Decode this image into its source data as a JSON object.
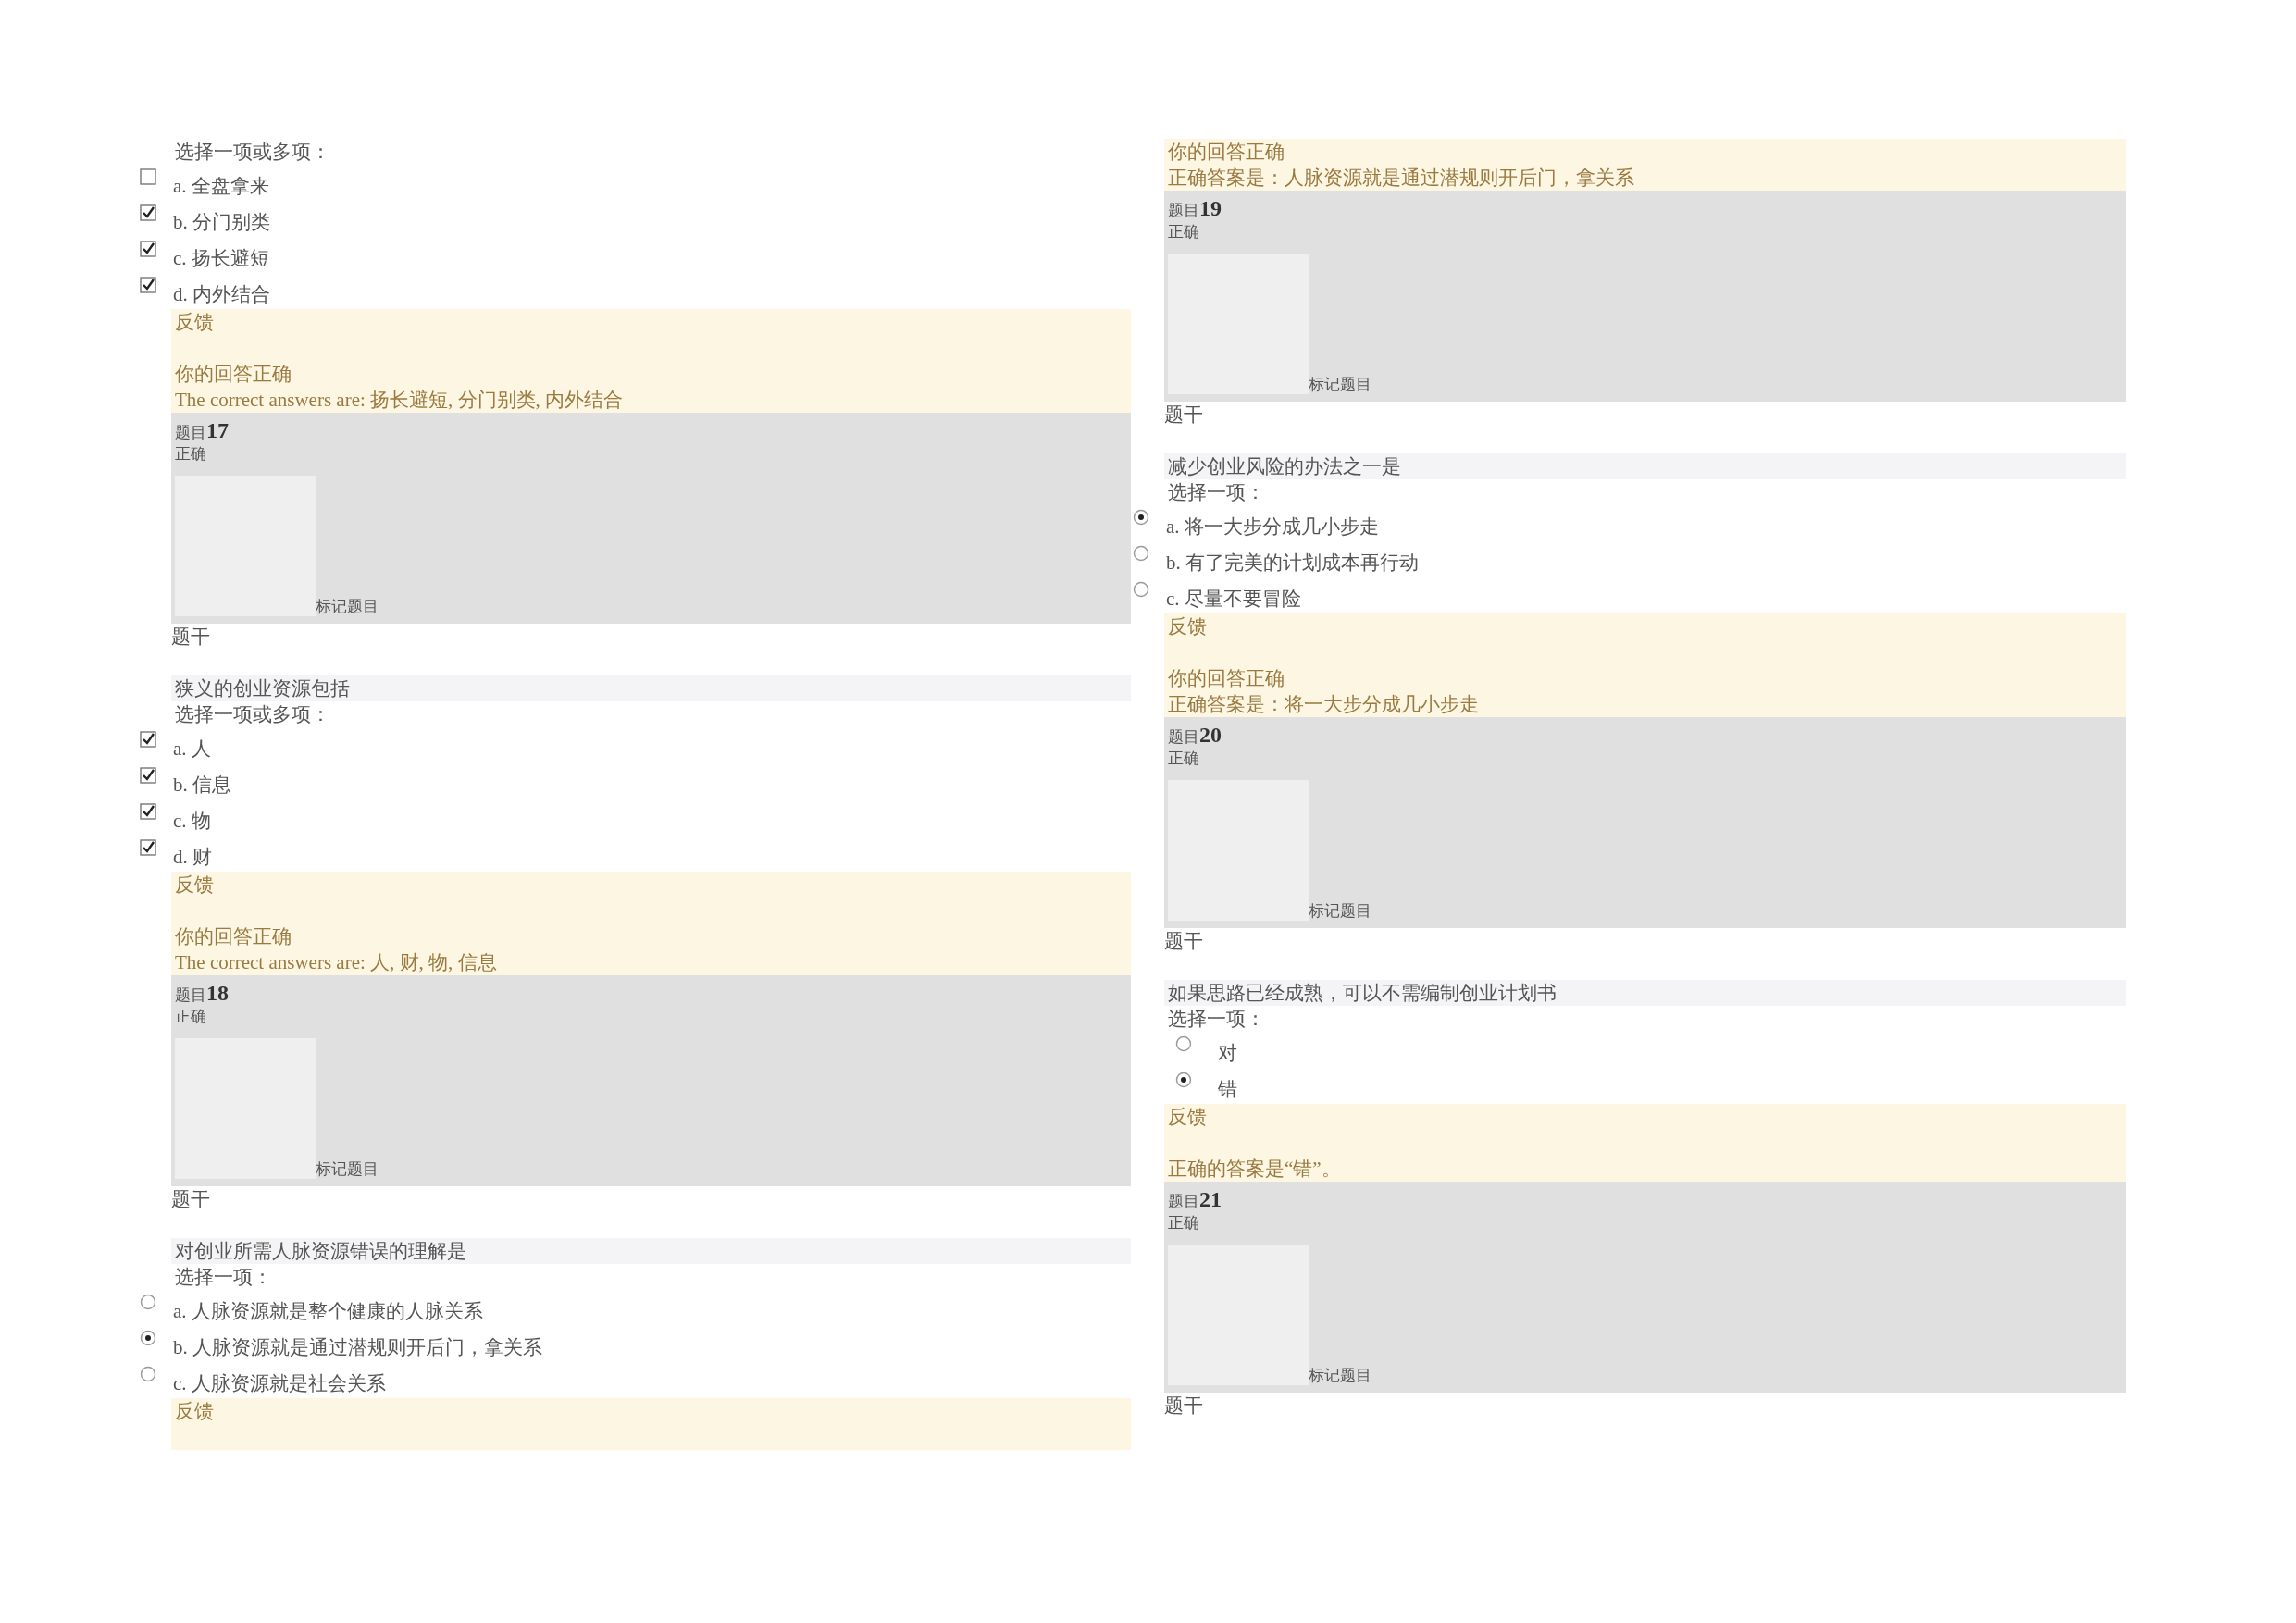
{
  "columns": [
    {
      "blocks": [
        {
          "kind": "question",
          "prompt": "选择一项或多项：",
          "options": [
            {
              "kind": "checkbox",
              "text": "a. 全盘拿来",
              "checked": false
            },
            {
              "kind": "checkbox",
              "text": "b. 分门别类",
              "checked": true
            },
            {
              "kind": "checkbox",
              "text": "c. 扬长避短",
              "checked": true
            },
            {
              "kind": "checkbox",
              "text": "d. 内外结合",
              "checked": true
            }
          ]
        },
        {
          "kind": "feedback",
          "title": "反馈",
          "lines": [
            "你的回答正确",
            "The correct answers are: 扬长避短, 分门别类, 内外结合"
          ]
        },
        {
          "kind": "info",
          "label": "题目",
          "number": "17",
          "status": "正确",
          "flag": "标记题目"
        },
        {
          "kind": "question",
          "stem_label": "题干",
          "text": "狭义的创业资源包括",
          "prompt": "选择一项或多项：",
          "options": [
            {
              "kind": "checkbox",
              "text": "a. 人",
              "checked": true
            },
            {
              "kind": "checkbox",
              "text": "b. 信息",
              "checked": true
            },
            {
              "kind": "checkbox",
              "text": "c. 物",
              "checked": true
            },
            {
              "kind": "checkbox",
              "text": "d. 财",
              "checked": true
            }
          ]
        },
        {
          "kind": "feedback",
          "title": "反馈",
          "lines": [
            "你的回答正确",
            "The correct answers are: 人, 财, 物, 信息"
          ]
        },
        {
          "kind": "info",
          "label": "题目",
          "number": "18",
          "status": "正确",
          "flag": "标记题目"
        },
        {
          "kind": "question",
          "stem_label": "题干",
          "text": "对创业所需人脉资源错误的理解是",
          "prompt": "选择一项：",
          "options": [
            {
              "kind": "radio",
              "text": "a. 人脉资源就是整个健康的人脉关系",
              "selected": false
            },
            {
              "kind": "radio",
              "text": "b. 人脉资源就是通过潜规则开后门，拿关系",
              "selected": true
            },
            {
              "kind": "radio",
              "text": "c. 人脉资源就是社会关系",
              "selected": false
            }
          ]
        },
        {
          "kind": "feedback",
          "title": "反馈"
        }
      ]
    },
    {
      "blocks": [
        {
          "kind": "feedback",
          "lines": [
            "你的回答正确",
            "正确答案是：人脉资源就是通过潜规则开后门，拿关系"
          ]
        },
        {
          "kind": "info",
          "label": "题目",
          "number": "19",
          "status": "正确",
          "flag": "标记题目"
        },
        {
          "kind": "question",
          "stem_label": "题干",
          "text": "减少创业风险的办法之一是",
          "prompt": "选择一项：",
          "options": [
            {
              "kind": "radio",
              "text": "a. 将一大步分成几小步走",
              "selected": true
            },
            {
              "kind": "radio",
              "text": "b. 有了完美的计划成本再行动",
              "selected": false
            },
            {
              "kind": "radio",
              "text": "c. 尽量不要冒险",
              "selected": false
            }
          ]
        },
        {
          "kind": "feedback",
          "title": "反馈",
          "lines": [
            "你的回答正确",
            "正确答案是：将一大步分成几小步走"
          ]
        },
        {
          "kind": "info",
          "label": "题目",
          "number": "20",
          "status": "正确",
          "flag": "标记题目"
        },
        {
          "kind": "question",
          "stem_label": "题干",
          "text": "如果思路已经成熟，可以不需编制创业计划书",
          "prompt": "选择一项：",
          "options": [
            {
              "kind": "inlineradio",
              "text": "对",
              "selected": false
            },
            {
              "kind": "inlineradio",
              "text": "错",
              "selected": true
            }
          ]
        },
        {
          "kind": "feedback",
          "title": "反馈",
          "lines": [
            "正确的答案是“错”。"
          ]
        },
        {
          "kind": "info",
          "label": "题目",
          "number": "21",
          "status": "正确",
          "flag": "标记题目"
        },
        {
          "kind": "question",
          "stem_label": "题干"
        }
      ]
    }
  ]
}
